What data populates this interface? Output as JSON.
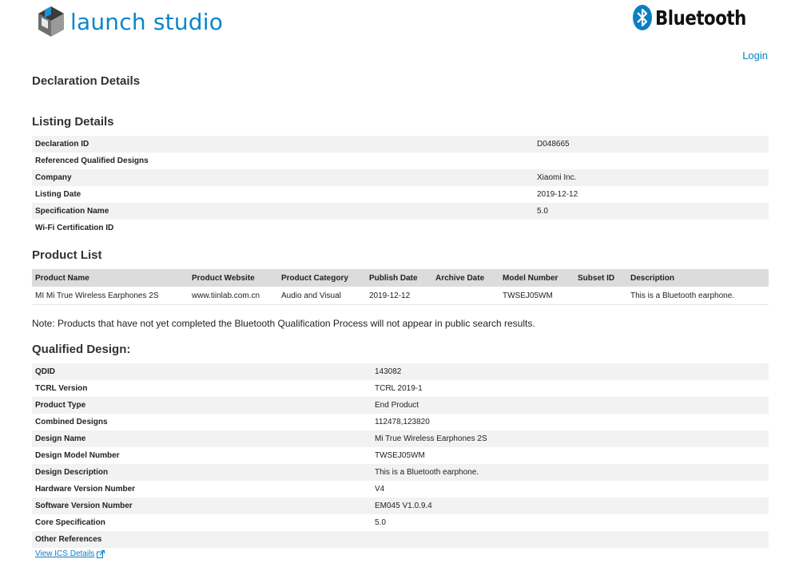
{
  "brand": {
    "logo_text": "launch studio",
    "bluetooth_text": "Bluetooth"
  },
  "header": {
    "login_label": "Login"
  },
  "page": {
    "title": "Declaration Details"
  },
  "listing": {
    "heading": "Listing Details",
    "rows": [
      {
        "label": "Declaration ID",
        "value": "D048665"
      },
      {
        "label": "Referenced Qualified Designs",
        "value": ""
      },
      {
        "label": "Company",
        "value": "Xiaomi Inc."
      },
      {
        "label": "Listing Date",
        "value": "2019-12-12"
      },
      {
        "label": "Specification Name",
        "value": "5.0"
      },
      {
        "label": "Wi-Fi Certification ID",
        "value": ""
      }
    ]
  },
  "products": {
    "heading": "Product List",
    "columns": [
      "Product Name",
      "Product Website",
      "Product Category",
      "Publish Date",
      "Archive Date",
      "Model Number",
      "Subset ID",
      "Description"
    ],
    "rows": [
      [
        "MI Mi True Wireless Earphones 2S",
        "www.tiinlab.com.cn",
        "Audio and Visual",
        "2019-12-12",
        "",
        "TWSEJ05WM",
        "",
        "This is a Bluetooth earphone."
      ]
    ],
    "note": "Note: Products that have not yet completed the Bluetooth Qualification Process will not appear in public search results."
  },
  "qualified": {
    "heading": "Qualified Design:",
    "rows": [
      {
        "label": "QDID",
        "value": "143082"
      },
      {
        "label": "TCRL Version",
        "value": "TCRL 2019-1"
      },
      {
        "label": "Product Type",
        "value": "End Product"
      },
      {
        "label": "Combined Designs",
        "value": "112478,123820"
      },
      {
        "label": "Design Name",
        "value": "Mi True Wireless Earphones 2S"
      },
      {
        "label": "Design Model Number",
        "value": "TWSEJ05WM"
      },
      {
        "label": "Design Description",
        "value": "This is a Bluetooth earphone."
      },
      {
        "label": "Hardware Version Number",
        "value": "V4"
      },
      {
        "label": "Software Version Number",
        "value": "EM045 V1.0.9.4"
      },
      {
        "label": "Core Specification",
        "value": "5.0"
      },
      {
        "label": "Other References",
        "value": ""
      }
    ],
    "ics_link": "View ICS Details"
  },
  "colors": {
    "accent": "#0a86c9",
    "link": "#0a7fc2",
    "row_shade": "#f2f2f2",
    "header_shade": "#dcdcdc"
  }
}
